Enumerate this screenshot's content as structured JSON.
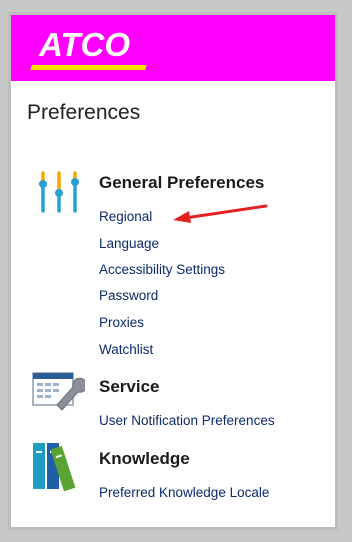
{
  "brand": {
    "logo_text": "ATCO",
    "header_color": "#ff00ff",
    "accent_color": "#ffe000"
  },
  "page": {
    "title": "Preferences"
  },
  "sections": [
    {
      "title": "General Preferences",
      "icon": "sliders-icon",
      "links": [
        "Regional",
        "Language",
        "Accessibility Settings",
        "Password",
        "Proxies",
        "Watchlist"
      ]
    },
    {
      "title": "Service",
      "icon": "form-wrench-icon",
      "links": [
        "User Notification Preferences"
      ]
    },
    {
      "title": "Knowledge",
      "icon": "books-icon",
      "links": [
        "Preferred Knowledge Locale"
      ]
    }
  ],
  "annotation": {
    "arrow_color": "#e52222",
    "arrow_points_to": "Regional"
  }
}
